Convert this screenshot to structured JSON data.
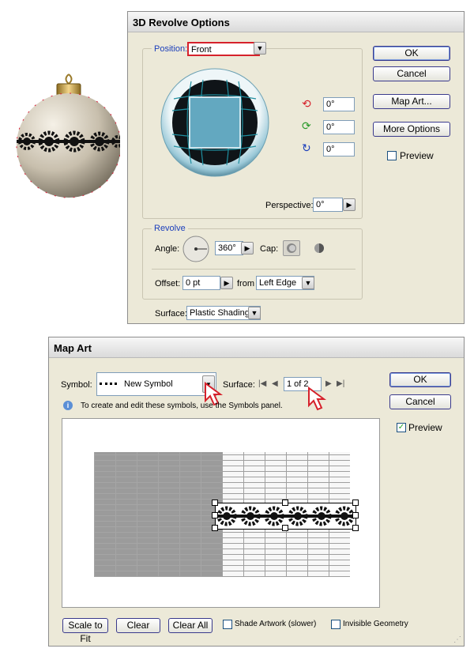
{
  "revolve_dialog": {
    "title": "3D Revolve Options",
    "position_label": "Position:",
    "position_value": "Front",
    "rot_x": "0°",
    "rot_y": "0°",
    "rot_z": "0°",
    "perspective_label": "Perspective:",
    "perspective_value": "0°",
    "revolve_group": "Revolve",
    "angle_label": "Angle:",
    "angle_value": "360°",
    "cap_label": "Cap:",
    "offset_label": "Offset:",
    "offset_value": "0 pt",
    "from_label": "from",
    "from_value": "Left Edge",
    "surface_label": "Surface:",
    "surface_value": "Plastic Shading",
    "ok": "OK",
    "cancel": "Cancel",
    "map_art": "Map Art...",
    "more_options": "More Options",
    "preview": "Preview"
  },
  "map_dialog": {
    "title": "Map Art",
    "symbol_label": "Symbol:",
    "symbol_value": "New Symbol",
    "surface_label": "Surface:",
    "surface_value": "1 of 2",
    "info_text": "To create and edit these symbols, use the Symbols panel.",
    "ok": "OK",
    "cancel": "Cancel",
    "preview": "Preview",
    "preview_checked": true,
    "scale_to_fit": "Scale to Fit",
    "clear": "Clear",
    "clear_all": "Clear All",
    "shade_artwork": "Shade Artwork (slower)",
    "invisible_geometry": "Invisible Geometry"
  },
  "colors": {
    "dialog_bg": "#ece9d8",
    "accent_blue": "#1c3fbb",
    "cursor_red": "#d6212b",
    "ornament_gold": "#c9a24a",
    "ornament_body": "#cbc3b2",
    "cube_face": "#63a8c0"
  }
}
